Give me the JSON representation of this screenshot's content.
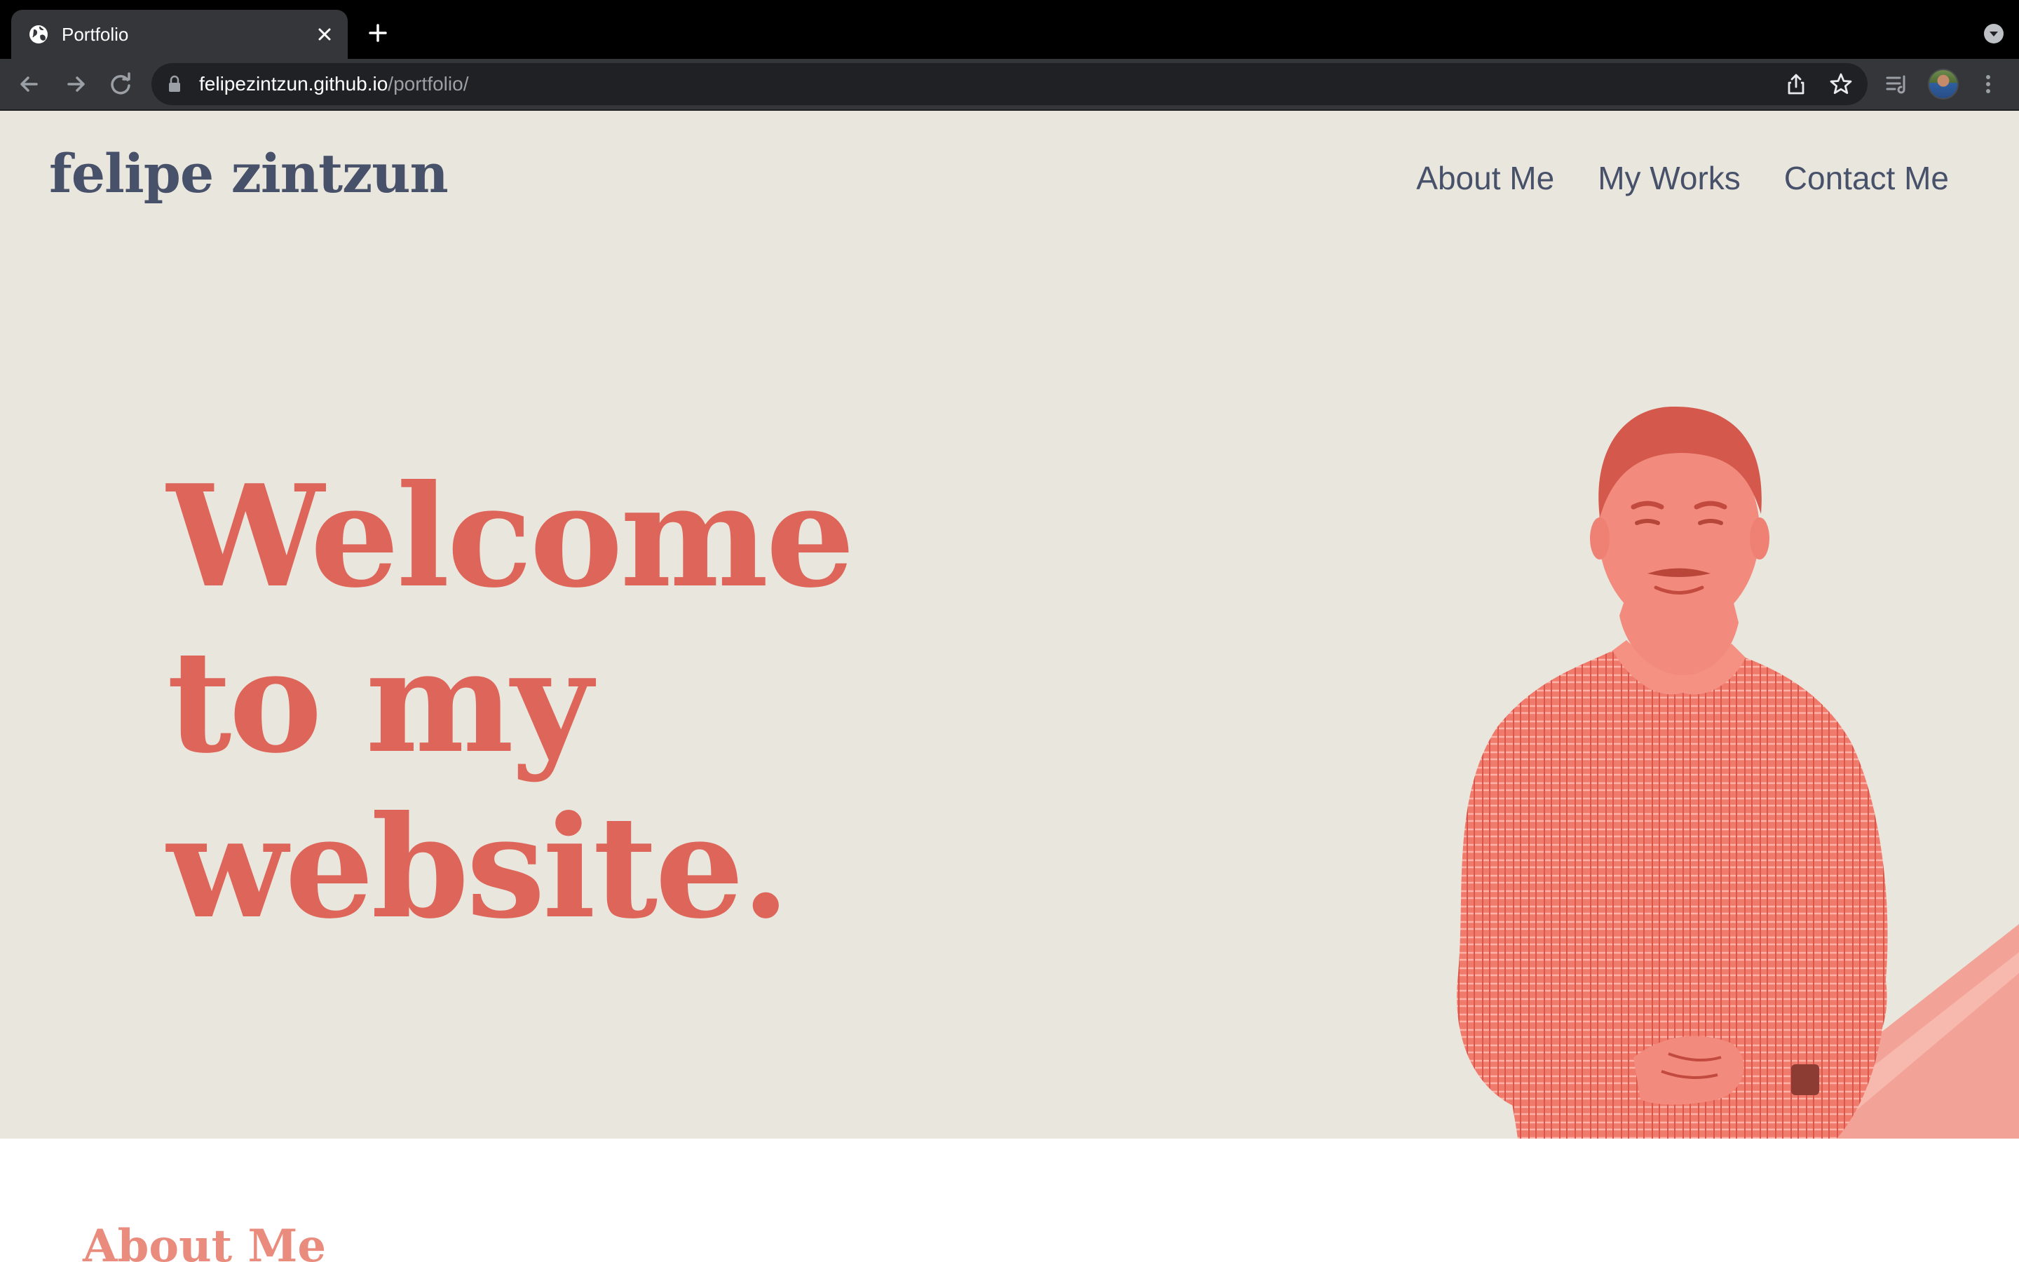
{
  "browser": {
    "tab_title": "Portfolio",
    "url_host": "felipezintzun.github.io",
    "url_path": "/portfolio/"
  },
  "site": {
    "name": "felipe zintzun",
    "nav": [
      "About Me",
      "My Works",
      "Contact Me"
    ],
    "hero_lines": [
      "Welcome",
      "to my",
      "website."
    ],
    "about_heading": "About Me"
  },
  "colors": {
    "hero_background": "#e9e6dd",
    "accent_red": "#de6559",
    "nav_text": "#48516a",
    "portrait_tint": "#f07a6c"
  },
  "icons": [
    "globe-icon",
    "close-icon",
    "plus-icon",
    "chevron-down-icon",
    "back-arrow-icon",
    "forward-arrow-icon",
    "reload-icon",
    "lock-icon",
    "share-icon",
    "star-icon",
    "reading-list-icon",
    "kebab-menu-icon"
  ]
}
